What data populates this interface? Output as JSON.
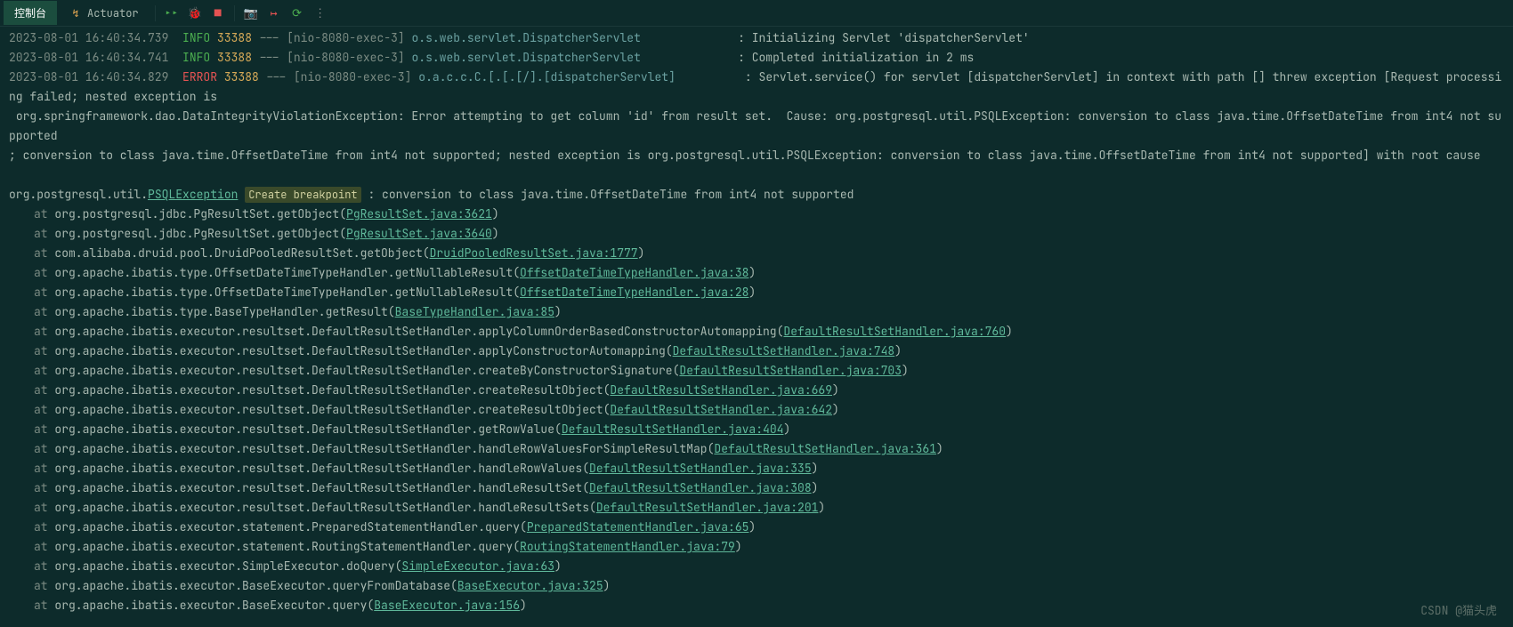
{
  "tabs": {
    "console": "控制台",
    "actuator": "Actuator"
  },
  "icons": {
    "actuator": "↯",
    "rerun": "▸▸",
    "bug": "🐞",
    "stop": "■",
    "camera": "📷",
    "exit": "↦",
    "refresh": "⟳",
    "more": "⋮"
  },
  "log": [
    {
      "ts": "2023-08-01 16:40:34.739",
      "level": "INFO",
      "pid": "33388",
      "thread": "[nio-8080-exec-3]",
      "logger": "o.s.web.servlet.DispatcherServlet",
      "msg": ": Initializing Servlet 'dispatcherServlet'"
    },
    {
      "ts": "2023-08-01 16:40:34.741",
      "level": "INFO",
      "pid": "33388",
      "thread": "[nio-8080-exec-3]",
      "logger": "o.s.web.servlet.DispatcherServlet",
      "msg": ": Completed initialization in 2 ms"
    },
    {
      "ts": "2023-08-01 16:40:34.829",
      "level": "ERROR",
      "pid": "33388",
      "thread": "[nio-8080-exec-3]",
      "logger": "o.a.c.c.C.[.[.[/].[dispatcherServlet]",
      "msg": ": Servlet.service() for servlet [dispatcherServlet] in context with path [] threw exception [Request processing failed; nested exception is"
    }
  ],
  "wrap": [
    " org.springframework.dao.DataIntegrityViolationException: Error attempting to get column 'id' from result set.  Cause: org.postgresql.util.PSQLException: conversion to class java.time.OffsetDateTime from int4 not supported",
    "; conversion to class java.time.OffsetDateTime from int4 not supported; nested exception is org.postgresql.util.PSQLException: conversion to class java.time.OffsetDateTime from int4 not supported] with root cause"
  ],
  "exception": {
    "prefix": "org.postgresql.util.",
    "class": "PSQLException",
    "breakpoint": "Create breakpoint",
    "msg": " : conversion to class java.time.OffsetDateTime from int4 not supported"
  },
  "trace": [
    {
      "at": "at ",
      "loc": "org.postgresql.jdbc.PgResultSet.getObject(",
      "link": "PgResultSet.java:3621",
      "end": ")"
    },
    {
      "at": "at ",
      "loc": "org.postgresql.jdbc.PgResultSet.getObject(",
      "link": "PgResultSet.java:3640",
      "end": ")"
    },
    {
      "at": "at ",
      "loc": "com.alibaba.druid.pool.DruidPooledResultSet.getObject(",
      "link": "DruidPooledResultSet.java:1777",
      "end": ")"
    },
    {
      "at": "at ",
      "loc": "org.apache.ibatis.type.OffsetDateTimeTypeHandler.getNullableResult(",
      "link": "OffsetDateTimeTypeHandler.java:38",
      "end": ")"
    },
    {
      "at": "at ",
      "loc": "org.apache.ibatis.type.OffsetDateTimeTypeHandler.getNullableResult(",
      "link": "OffsetDateTimeTypeHandler.java:28",
      "end": ")"
    },
    {
      "at": "at ",
      "loc": "org.apache.ibatis.type.BaseTypeHandler.getResult(",
      "link": "BaseTypeHandler.java:85",
      "end": ")"
    },
    {
      "at": "at ",
      "loc": "org.apache.ibatis.executor.resultset.DefaultResultSetHandler.applyColumnOrderBasedConstructorAutomapping(",
      "link": "DefaultResultSetHandler.java:760",
      "end": ")"
    },
    {
      "at": "at ",
      "loc": "org.apache.ibatis.executor.resultset.DefaultResultSetHandler.applyConstructorAutomapping(",
      "link": "DefaultResultSetHandler.java:748",
      "end": ")"
    },
    {
      "at": "at ",
      "loc": "org.apache.ibatis.executor.resultset.DefaultResultSetHandler.createByConstructorSignature(",
      "link": "DefaultResultSetHandler.java:703",
      "end": ")"
    },
    {
      "at": "at ",
      "loc": "org.apache.ibatis.executor.resultset.DefaultResultSetHandler.createResultObject(",
      "link": "DefaultResultSetHandler.java:669",
      "end": ")"
    },
    {
      "at": "at ",
      "loc": "org.apache.ibatis.executor.resultset.DefaultResultSetHandler.createResultObject(",
      "link": "DefaultResultSetHandler.java:642",
      "end": ")"
    },
    {
      "at": "at ",
      "loc": "org.apache.ibatis.executor.resultset.DefaultResultSetHandler.getRowValue(",
      "link": "DefaultResultSetHandler.java:404",
      "end": ")"
    },
    {
      "at": "at ",
      "loc": "org.apache.ibatis.executor.resultset.DefaultResultSetHandler.handleRowValuesForSimpleResultMap(",
      "link": "DefaultResultSetHandler.java:361",
      "end": ")"
    },
    {
      "at": "at ",
      "loc": "org.apache.ibatis.executor.resultset.DefaultResultSetHandler.handleRowValues(",
      "link": "DefaultResultSetHandler.java:335",
      "end": ")"
    },
    {
      "at": "at ",
      "loc": "org.apache.ibatis.executor.resultset.DefaultResultSetHandler.handleResultSet(",
      "link": "DefaultResultSetHandler.java:308",
      "end": ")"
    },
    {
      "at": "at ",
      "loc": "org.apache.ibatis.executor.resultset.DefaultResultSetHandler.handleResultSets(",
      "link": "DefaultResultSetHandler.java:201",
      "end": ")"
    },
    {
      "at": "at ",
      "loc": "org.apache.ibatis.executor.statement.PreparedStatementHandler.query(",
      "link": "PreparedStatementHandler.java:65",
      "end": ")"
    },
    {
      "at": "at ",
      "loc": "org.apache.ibatis.executor.statement.RoutingStatementHandler.query(",
      "link": "RoutingStatementHandler.java:79",
      "end": ")"
    },
    {
      "at": "at ",
      "loc": "org.apache.ibatis.executor.SimpleExecutor.doQuery(",
      "link": "SimpleExecutor.java:63",
      "end": ")"
    },
    {
      "at": "at ",
      "loc": "org.apache.ibatis.executor.BaseExecutor.queryFromDatabase(",
      "link": "BaseExecutor.java:325",
      "end": ")"
    },
    {
      "at": "at ",
      "loc": "org.apache.ibatis.executor.BaseExecutor.query(",
      "link": "BaseExecutor.java:156",
      "end": ")"
    }
  ],
  "watermark": "CSDN @猫头虎"
}
